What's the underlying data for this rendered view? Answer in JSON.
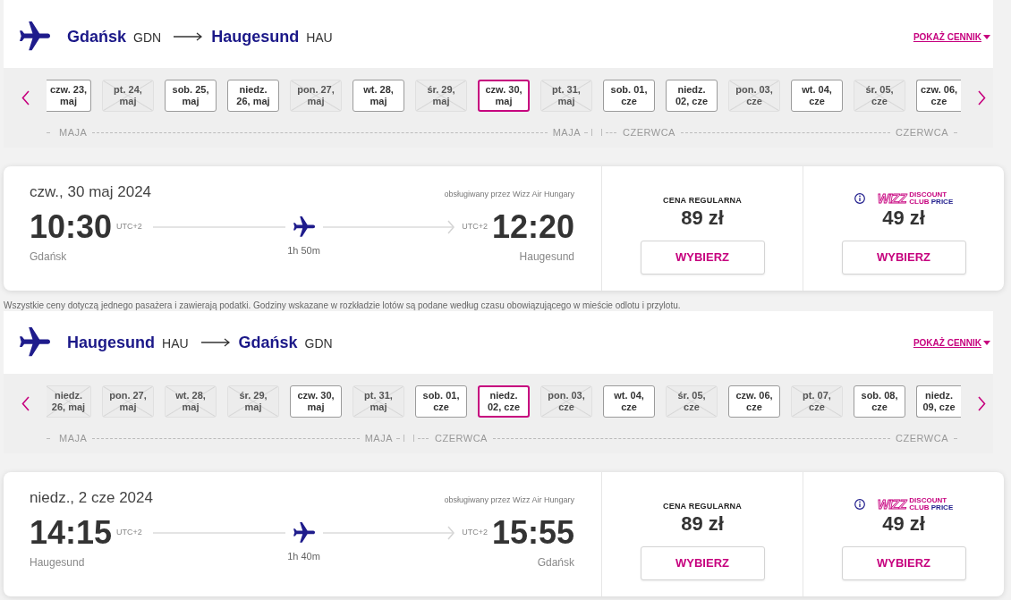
{
  "legs": [
    {
      "header": {
        "origin_city": "Gdańsk",
        "origin_code": "GDN",
        "destination_city": "Haugesund",
        "destination_code": "HAU",
        "price_table_link": "POKAŻ CENNIK"
      },
      "date_strip": {
        "months": [
          {
            "start_label": "MAJA",
            "end_label": "MAJA",
            "dates": [
              {
                "label": "czw. 23,\nmaj",
                "disabled": false,
                "selected": false
              },
              {
                "label": "pt. 24,\nmaj",
                "disabled": true,
                "selected": false
              },
              {
                "label": "sob. 25,\nmaj",
                "disabled": false,
                "selected": false
              },
              {
                "label": "niedz.\n26, maj",
                "disabled": false,
                "selected": false
              },
              {
                "label": "pon. 27,\nmaj",
                "disabled": true,
                "selected": false
              },
              {
                "label": "wt. 28,\nmaj",
                "disabled": false,
                "selected": false
              },
              {
                "label": "śr. 29,\nmaj",
                "disabled": true,
                "selected": false
              },
              {
                "label": "czw. 30,\nmaj",
                "disabled": false,
                "selected": true
              },
              {
                "label": "pt. 31,\nmaj",
                "disabled": true,
                "selected": false
              }
            ]
          },
          {
            "start_label": "CZERWCA",
            "end_label": "CZERWCA",
            "dates": [
              {
                "label": "sob. 01,\ncze",
                "disabled": false,
                "selected": false
              },
              {
                "label": "niedz.\n02, cze",
                "disabled": false,
                "selected": false
              },
              {
                "label": "pon. 03,\ncze",
                "disabled": true,
                "selected": false
              },
              {
                "label": "wt. 04,\ncze",
                "disabled": false,
                "selected": false
              },
              {
                "label": "śr. 05,\ncze",
                "disabled": true,
                "selected": false
              },
              {
                "label": "czw. 06,\ncze",
                "disabled": false,
                "selected": false
              }
            ]
          }
        ]
      },
      "flight": {
        "date": "czw., 30 maj 2024",
        "operator": "obsługiwany przez Wizz Air Hungary",
        "departure_time": "10:30",
        "departure_tz": "UTC+2",
        "arrival_tz": "UTC+2",
        "arrival_time": "12:20",
        "origin": "Gdańsk",
        "duration": "1h 50m",
        "destination": "Haugesund",
        "fares": [
          {
            "kind": "regular",
            "title": "CENA REGULARNA",
            "price": "89 zł",
            "button": "WYBIERZ"
          },
          {
            "kind": "club",
            "logo": {
              "wordmark": "WIZZ",
              "line_1": "DISCOUNT",
              "line_2a": "CLUB",
              "line_2b": "PRICE"
            },
            "price": "49 zł",
            "button": "WYBIERZ"
          }
        ]
      },
      "note": "Wszystkie ceny dotyczą jednego pasażera i zawierają podatki. Godziny wskazane w rozkładzie lotów są podane według czasu obowiązującego w mieście odlotu i przylotu."
    },
    {
      "header": {
        "origin_city": "Haugesund",
        "origin_code": "HAU",
        "destination_city": "Gdańsk",
        "destination_code": "GDN",
        "price_table_link": "POKAŻ CENNIK"
      },
      "date_strip": {
        "months": [
          {
            "start_label": "MAJA",
            "end_label": "MAJA",
            "dates": [
              {
                "label": "niedz.\n26, maj",
                "disabled": true,
                "selected": false
              },
              {
                "label": "pon. 27,\nmaj",
                "disabled": true,
                "selected": false
              },
              {
                "label": "wt. 28,\nmaj",
                "disabled": true,
                "selected": false
              },
              {
                "label": "śr. 29,\nmaj",
                "disabled": true,
                "selected": false
              },
              {
                "label": "czw. 30,\nmaj",
                "disabled": false,
                "selected": false
              },
              {
                "label": "pt. 31,\nmaj",
                "disabled": true,
                "selected": false
              }
            ]
          },
          {
            "start_label": "CZERWCA",
            "end_label": "CZERWCA",
            "dates": [
              {
                "label": "sob. 01,\ncze",
                "disabled": false,
                "selected": false
              },
              {
                "label": "niedz.\n02, cze",
                "disabled": false,
                "selected": true
              },
              {
                "label": "pon. 03,\ncze",
                "disabled": true,
                "selected": false
              },
              {
                "label": "wt. 04,\ncze",
                "disabled": false,
                "selected": false
              },
              {
                "label": "śr. 05,\ncze",
                "disabled": true,
                "selected": false
              },
              {
                "label": "czw. 06,\ncze",
                "disabled": false,
                "selected": false
              },
              {
                "label": "pt. 07,\ncze",
                "disabled": true,
                "selected": false
              },
              {
                "label": "sob. 08,\ncze",
                "disabled": false,
                "selected": false
              },
              {
                "label": "niedz.\n09, cze",
                "disabled": false,
                "selected": false
              }
            ]
          }
        ]
      },
      "flight": {
        "date": "niedz., 2 cze 2024",
        "operator": "obsługiwany przez Wizz Air Hungary",
        "departure_time": "14:15",
        "departure_tz": "UTC+2",
        "arrival_tz": "UTC+2",
        "arrival_time": "15:55",
        "origin": "Haugesund",
        "duration": "1h 40m",
        "destination": "Gdańsk",
        "fares": [
          {
            "kind": "regular",
            "title": "CENA REGULARNA",
            "price": "89 zł",
            "button": "WYBIERZ"
          },
          {
            "kind": "club",
            "logo": {
              "wordmark": "WIZZ",
              "line_1": "DISCOUNT",
              "line_2a": "CLUB",
              "line_2b": "PRICE"
            },
            "price": "49 zł",
            "button": "WYBIERZ"
          }
        ]
      }
    }
  ]
}
